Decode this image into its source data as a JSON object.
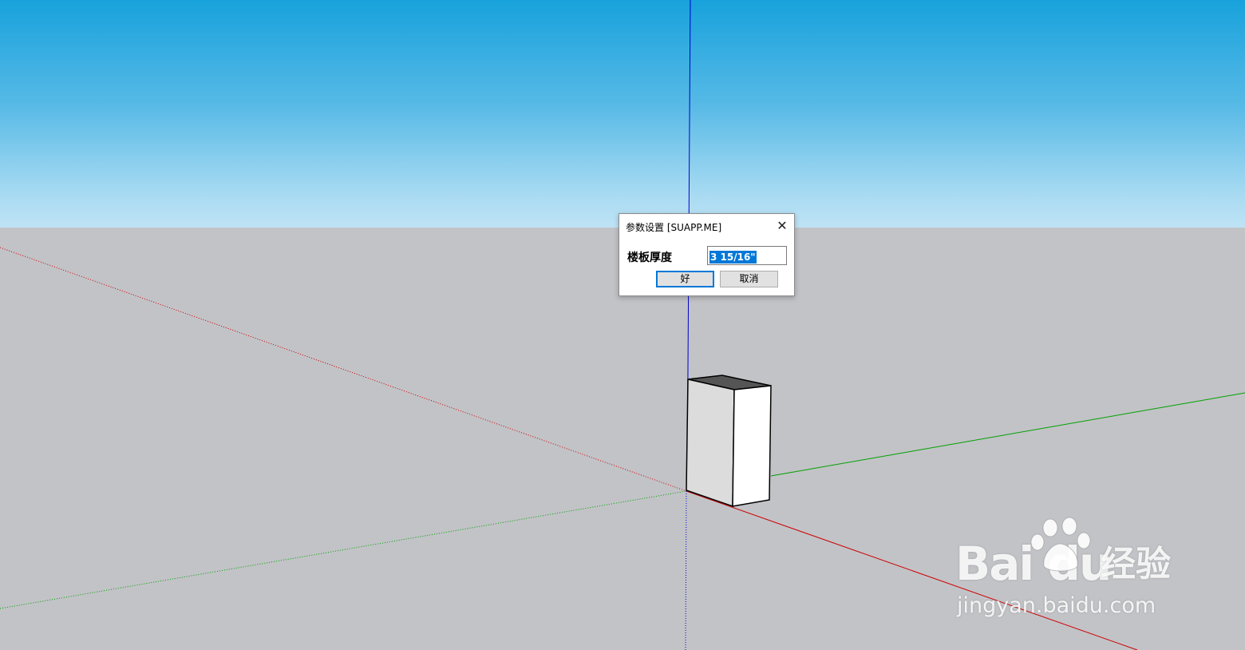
{
  "dialog": {
    "title": "参数设置 [SUAPP.ME]",
    "close_glyph": "✕",
    "param_label": "楼板厚度",
    "param_value": "3 15/16\"",
    "ok_label": "好",
    "cancel_label": "取消"
  },
  "watermark": {
    "brand": "Bai  du",
    "suffix": "经验",
    "url": "jingyan.baidu.com"
  },
  "colors": {
    "sky_top": "#18a2dc",
    "sky_bottom": "#bfe3f5",
    "ground": "#c2c3c7",
    "axis_red": "#cc0000",
    "axis_green": "#00a000",
    "axis_blue": "#0000cc",
    "selection": "#0078d7"
  },
  "icons": {
    "close": "close-icon",
    "watermark": "baidu-paw-icon"
  }
}
